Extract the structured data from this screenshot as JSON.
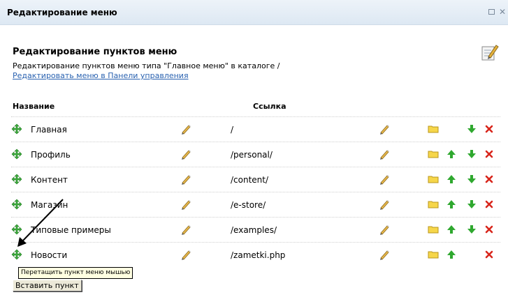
{
  "window": {
    "title": "Редактирование меню"
  },
  "header": {
    "heading": "Редактирование пунктов меню",
    "description": "Редактирование пунктов меню типа \"Главное меню\" в каталоге /",
    "link": "Редактировать меню в Панели управления"
  },
  "table": {
    "col_name": "Название",
    "col_link": "Ссылка",
    "rows": [
      {
        "name": "Главная",
        "link": "/",
        "up": false,
        "down": true
      },
      {
        "name": "Профиль",
        "link": "/personal/",
        "up": true,
        "down": true
      },
      {
        "name": "Контент",
        "link": "/content/",
        "up": true,
        "down": true
      },
      {
        "name": "Магазин",
        "link": "/e-store/",
        "up": true,
        "down": true
      },
      {
        "name": "Типовые примеры",
        "link": "/examples/",
        "up": true,
        "down": true
      },
      {
        "name": "Новости",
        "link": "/zametki.php",
        "up": true,
        "down": false
      }
    ]
  },
  "tooltip": "Перетащить пункт меню мышью",
  "insert_button": "Вставить пункт",
  "colors": {
    "titlebar": "#dde8f3",
    "link": "#2a62b0",
    "arrow_green": "#2fa82f",
    "delete_red": "#d8261c",
    "folder": "#f6d64a"
  }
}
